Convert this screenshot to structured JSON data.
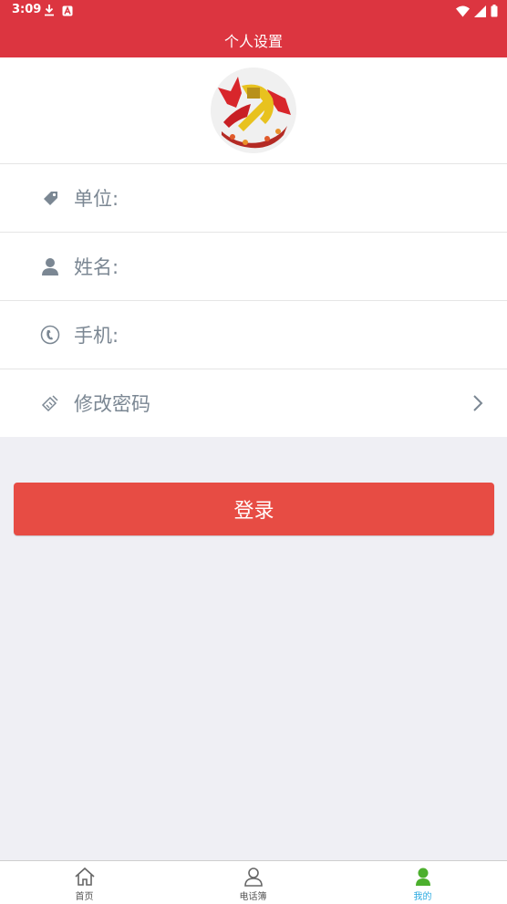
{
  "status_bar": {
    "time": "3:09",
    "background_color": "#dc3540",
    "icons": [
      "download-icon",
      "a-badge-icon",
      "wifi-icon",
      "signal-icon",
      "battery-icon"
    ]
  },
  "header": {
    "title": "个人设置",
    "background_color": "#dc3540"
  },
  "profile": {
    "avatar_icon": "party-emblem-avatar"
  },
  "info_rows": [
    {
      "label": "单位:",
      "icon": "tag-icon"
    },
    {
      "label": "姓名:",
      "icon": "person-icon"
    },
    {
      "label": "手机:",
      "icon": "phone-icon"
    },
    {
      "label": "修改密码",
      "icon": "edit-password-icon",
      "chevron": "chevron-right-icon"
    }
  ],
  "login_button": {
    "label": "登录",
    "background_color": "#e74c44"
  },
  "tabbar": {
    "active_color": "#2aa9e0",
    "items": [
      {
        "label": "首页",
        "icon": "home-icon"
      },
      {
        "label": "电话簿",
        "icon": "contacts-icon"
      },
      {
        "label": "我的",
        "icon": "profile-icon",
        "active": true
      }
    ]
  }
}
